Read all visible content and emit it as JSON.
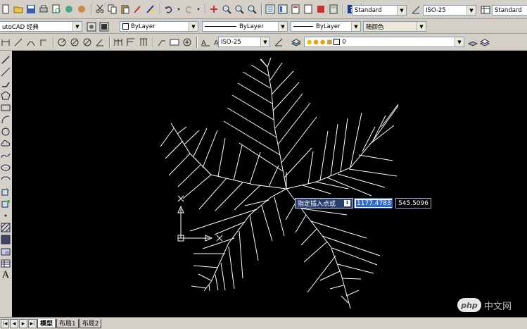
{
  "toolbar_row1": {
    "text_style": "Standard",
    "dim_style": "ISO-25",
    "table_style": "Standard"
  },
  "toolbar_row2": {
    "workspace": "utoCAD 经典",
    "layer_color": "ByLayer",
    "linetype": "ByLayer",
    "lineweight": "ByLayer",
    "plot_style": "随颜色"
  },
  "toolbar_row3": {
    "dim_style": "ISO-25",
    "layer_name": "0"
  },
  "command_input": {
    "prompt": "指定插入点或",
    "x_value": "1177.4783",
    "y_value": "545.5096"
  },
  "layout_tabs": [
    {
      "label": "模型",
      "active": true
    },
    {
      "label": "布局1",
      "active": false
    },
    {
      "label": "布局2",
      "active": false
    }
  ],
  "watermark": {
    "logo": "php",
    "text": "中文网"
  },
  "colors": {
    "canvas": "#000000",
    "lines": "#ffffff",
    "toolbar": "#d4d0c8",
    "prompt_bg": "#2a3f6e",
    "highlight": "#316ac5"
  }
}
